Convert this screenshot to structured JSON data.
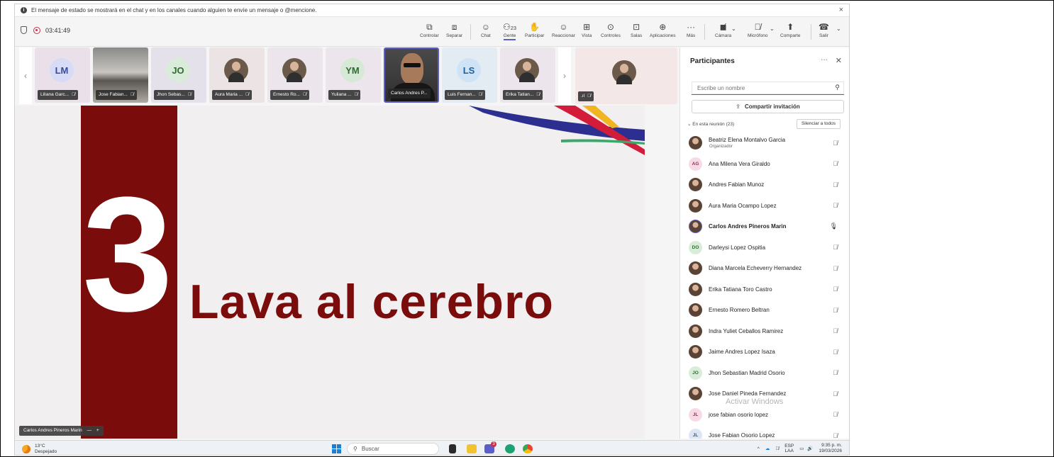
{
  "notification": {
    "text": "El mensaje de estado se mostrará en el chat y en los canales cuando alguien te envíe un mensaje o @mencione.",
    "close": "×"
  },
  "meeting": {
    "timer": "03:41:49"
  },
  "toolbar": {
    "controlar": "Controlar",
    "separar": "Separar",
    "chat": "Chat",
    "gente": "Gente",
    "people_count": "23",
    "participar": "Participar",
    "reaccionar": "Reaccionar",
    "vista": "Vista",
    "controles": "Controles",
    "salas": "Salas",
    "aplicaciones": "Aplicaciones",
    "mas": "Más",
    "camara": "Cámara",
    "microfono": "Micrófono",
    "comparte": "Comparte",
    "salir": "Salir"
  },
  "strip": {
    "tiles": [
      {
        "initials": "LM",
        "name": "Liliana Garc...",
        "bg": "#e9e0ea",
        "avbg": "#d6dcf5",
        "avfg": "#3b4a9a"
      },
      {
        "initials": "",
        "name": "Jose Fabian...",
        "bg": "#b5b0aa"
      },
      {
        "initials": "JO",
        "name": "Jhon Sebas...",
        "bg": "#e4e1ea",
        "avbg": "#d9ecd9",
        "avfg": "#2f6b2f"
      },
      {
        "initials": "",
        "name": "Aura Maria ...",
        "bg": "#ece4e4"
      },
      {
        "initials": "",
        "name": "Ernesto Ro...",
        "bg": "#ece6ec"
      },
      {
        "initials": "YM",
        "name": "Yuliana ...",
        "bg": "#ece6ec",
        "avbg": "#d6e8d6",
        "avfg": "#2f6b2f"
      },
      {
        "initials": "",
        "name": "Carlos Andres P..."
      },
      {
        "initials": "LS",
        "name": "Luis Fernan...",
        "bg": "#e4ecf3",
        "avbg": "#cfe3f6",
        "avfg": "#1f5f9a"
      },
      {
        "initials": "",
        "name": "Erika Tatian...",
        "bg": "#ece6ec"
      }
    ],
    "big_tile_label": ".ıl"
  },
  "slide": {
    "number": "3",
    "title": "Lava al cerebro",
    "speaker_name": "Carlos Andres Pineros Marin"
  },
  "panel": {
    "title": "Participantes",
    "search_placeholder": "Escribe un nombre",
    "invite_label": "Compartir invitación",
    "section_label": "En esta reunión (23)",
    "mute_all": "Silenciar a todos",
    "participants": [
      {
        "name": "Beatriz Elena Montalvo Garcia",
        "role": "Organizador",
        "initials": "",
        "photo": true
      },
      {
        "name": "Ana Milena Vera Giraldo",
        "initials": "AG",
        "avbg": "#f6dbe6",
        "avfg": "#9a2f5a"
      },
      {
        "name": "Andres Fabian Munoz",
        "initials": "",
        "photo": true
      },
      {
        "name": "Aura Maria Ocampo Lopez",
        "initials": "",
        "photo": true
      },
      {
        "name": "Carlos Andres Pineros Marin",
        "initials": "",
        "photo": true,
        "active": true
      },
      {
        "name": "Darleysi Lopez Ospitia",
        "initials": "DO",
        "avbg": "#d9ecd9",
        "avfg": "#2f6b2f"
      },
      {
        "name": "Diana Marcela Echeverry Hernandez",
        "initials": "",
        "photo": true
      },
      {
        "name": "Erika Tatiana Toro Castro",
        "initials": "",
        "photo": true
      },
      {
        "name": "Ernesto Romero Beltran",
        "initials": "",
        "photo": true
      },
      {
        "name": "Indra Yuliet Ceballos Ramirez",
        "initials": "",
        "photo": true
      },
      {
        "name": "Jaime Andres Lopez Isaza",
        "initials": "",
        "photo": true
      },
      {
        "name": "Jhon Sebastian Madrid Osorio",
        "initials": "JO",
        "avbg": "#d9ecd9",
        "avfg": "#2f6b2f"
      },
      {
        "name": "Jose Daniel Pineda Fernandez",
        "initials": "",
        "photo": true
      },
      {
        "name": "jose fabian osorio lopez",
        "initials": "JL",
        "avbg": "#f6dbe6",
        "avfg": "#9a2f5a"
      },
      {
        "name": "Jose Fabian Osorio Lopez",
        "initials": "JL",
        "avbg": "#dde6f3",
        "avfg": "#3a5a8a"
      }
    ],
    "watermark_title": "Activar Windows",
    "watermark_sub": "Ve a Configuración para activar Windows."
  },
  "taskbar": {
    "temp": "13°C",
    "weather": "Despejado",
    "search": "Buscar",
    "lang1": "ESP",
    "lang2": "LAA",
    "time": "9:35 p. m.",
    "date": "19/03/2026",
    "teams_badge": "3"
  }
}
